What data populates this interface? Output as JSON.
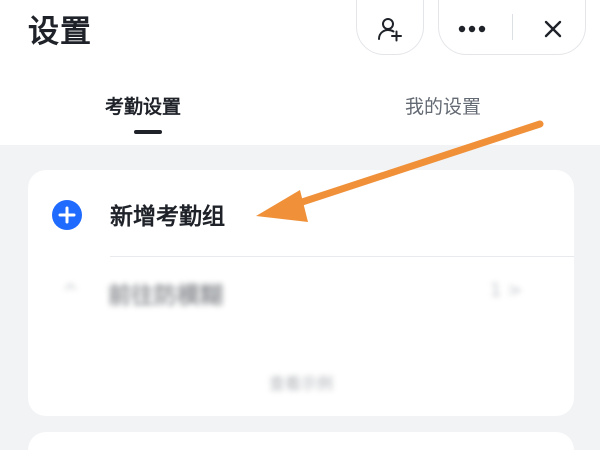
{
  "header": {
    "title": "设置",
    "add_member_icon": "add-person-icon",
    "more_icon": "more-dots-icon",
    "close_icon": "close-icon"
  },
  "tabs": [
    {
      "label": "考勤设置",
      "active": true
    },
    {
      "label": "我的设置",
      "active": false
    }
  ],
  "card": {
    "add_group_label": "新增考勤组",
    "add_group_icon": "plus-circle-icon",
    "blurred_row_label": "前往防模糊",
    "blurred_row_count": "1 >",
    "blurred_footer": "查看示例"
  },
  "annotation": {
    "arrow_color": "#f0913a",
    "points_to": "新增考勤组"
  },
  "colors": {
    "accent": "#1f6bff",
    "background": "#f2f3f5",
    "text": "#1f2329"
  }
}
